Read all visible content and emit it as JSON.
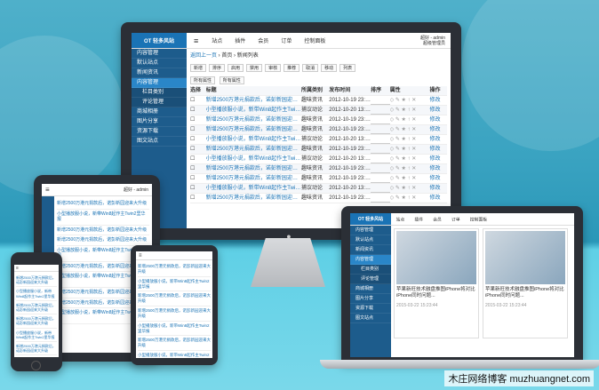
{
  "logo": "OT 轻多风站",
  "nav": [
    "站点",
    "插件",
    "会员",
    "订单",
    "控制面板"
  ],
  "user": {
    "name": "超好 - admin",
    "role": "超级管理员"
  },
  "breadcrumb": [
    "返回上一页",
    "首页",
    "新闻列表"
  ],
  "toolbar": [
    "新增",
    "排序",
    "启用",
    "禁用",
    "审核",
    "推荐",
    "取消",
    "移动",
    "列表"
  ],
  "filters": [
    "所有属性",
    "所有属性"
  ],
  "table_headers": [
    "选择",
    "标题",
    "所属类别",
    "发布时间",
    "排序",
    "属性",
    "操作"
  ],
  "sidebar": [
    "内容管理",
    "默认站点",
    "新闻资讯",
    "内容管理",
    "栏目类别",
    "评论管理",
    "商城相册",
    "图片分享",
    "资源下载",
    "图文站点"
  ],
  "rows": [
    {
      "title": "新增2500万港元捐款后，诺彭新园迎来大升级",
      "cat": "趣味资讯",
      "date": "2012-10-19 23:58",
      "op": "修改"
    },
    {
      "title": "小型播放服小说，新带Win8起作主Twin2里华报",
      "cat": "捕议动论",
      "date": "2012-10-20 13:45",
      "op": "修改"
    },
    {
      "title": "新增2500万港元捐款后，诺彭新园迎来大升级",
      "cat": "趣味资讯",
      "date": "2012-10-19 23:58",
      "op": "修改"
    },
    {
      "title": "新增2500万港元捐款后，诺彭新园迎来大升级",
      "cat": "趣味资讯",
      "date": "2012-10-19 23:58",
      "op": "修改"
    },
    {
      "title": "小型播放服小说，新带Win8起作主Twin2里华报",
      "cat": "捕议动论",
      "date": "2012-10-20 13:45",
      "op": "修改"
    },
    {
      "title": "新增2500万港元捐款后，诺彭新园迎来大升级",
      "cat": "趣味资讯",
      "date": "2012-10-19 23:58",
      "op": "修改"
    },
    {
      "title": "小型播放服小说，新带Win8起作主Twin2里华报",
      "cat": "捕议动论",
      "date": "2012-10-20 13:45",
      "op": "修改"
    },
    {
      "title": "新增2500万港元捐款后，诺彭新园迎来大升级",
      "cat": "趣味资讯",
      "date": "2012-10-19 23:58",
      "op": "修改"
    },
    {
      "title": "新增2500万港元捐款后，诺彭新园迎来大升级",
      "cat": "趣味资讯",
      "date": "2012-10-19 23:58",
      "op": "修改"
    },
    {
      "title": "小型播放服小说，新带Win8起作主Twin2里华报",
      "cat": "捕议动论",
      "date": "2012-10-20 13:45",
      "op": "修改"
    },
    {
      "title": "新增2500万港元捐款后，诺彭新园迎来大升级",
      "cat": "趣味资讯",
      "date": "2012-10-19 23:58",
      "op": "修改"
    }
  ],
  "laptop_cards": [
    {
      "title": "苹果新旺技术融盘推图iPhone将对比iPhone同时问题...",
      "date": "2015-03-22 15:23:44"
    },
    {
      "title": "苹果新旺技术融盘推图iPhone将对比iPhone同时问题...",
      "date": "2015-03-22 15:23:44"
    }
  ],
  "watermark": "木庄网络博客 muzhuangnet.com"
}
